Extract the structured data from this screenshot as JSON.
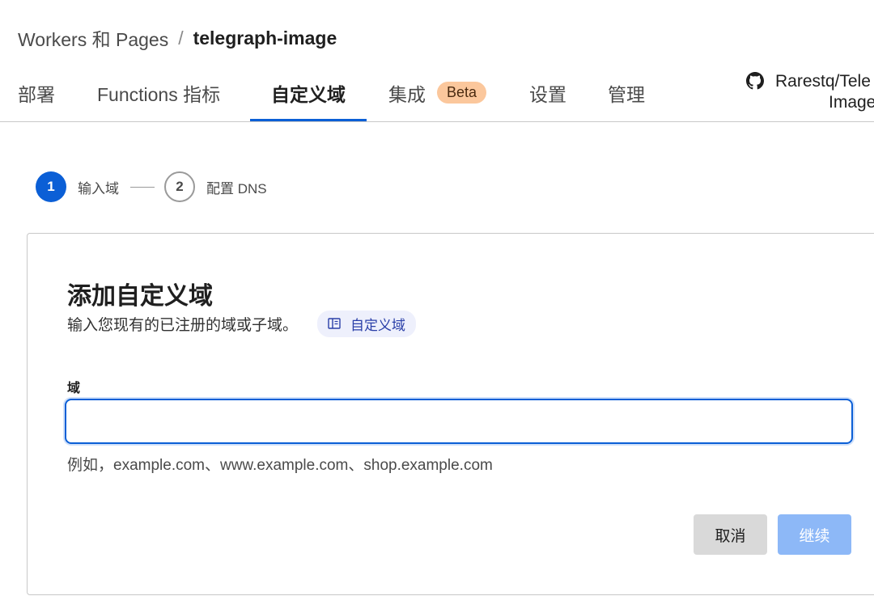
{
  "breadcrumb": {
    "parent": "Workers 和 Pages",
    "separator": "/",
    "current": "telegraph-image"
  },
  "tabs": [
    {
      "label": "部署"
    },
    {
      "label": "Functions 指标"
    },
    {
      "label": "自定义域",
      "active": true
    },
    {
      "label": "集成",
      "badge": "Beta"
    },
    {
      "label": "设置"
    },
    {
      "label": "管理"
    }
  ],
  "repo": {
    "icon": "github-icon",
    "line1": "Rarestq/Tele",
    "line2": "Image"
  },
  "stepper": {
    "steps": [
      {
        "number": "1",
        "label": "输入域",
        "active": true
      },
      {
        "number": "2",
        "label": "配置 DNS",
        "active": false
      }
    ]
  },
  "card": {
    "title": "添加自定义域",
    "subtitle": "输入您现有的已注册的域或子域。",
    "doc_link": {
      "icon": "book-icon",
      "label": "自定义域"
    },
    "field_label": "域",
    "input_value": "",
    "hint": "例如，example.com、www.example.com、shop.example.com",
    "cancel_label": "取消",
    "continue_label": "继续"
  },
  "colors": {
    "accent": "#0b5fd6",
    "badge_bg": "#fbc79c",
    "continue_bg": "#8db8f7",
    "cancel_bg": "#d9d9d9",
    "doc_chip_bg": "#eef0fc"
  }
}
